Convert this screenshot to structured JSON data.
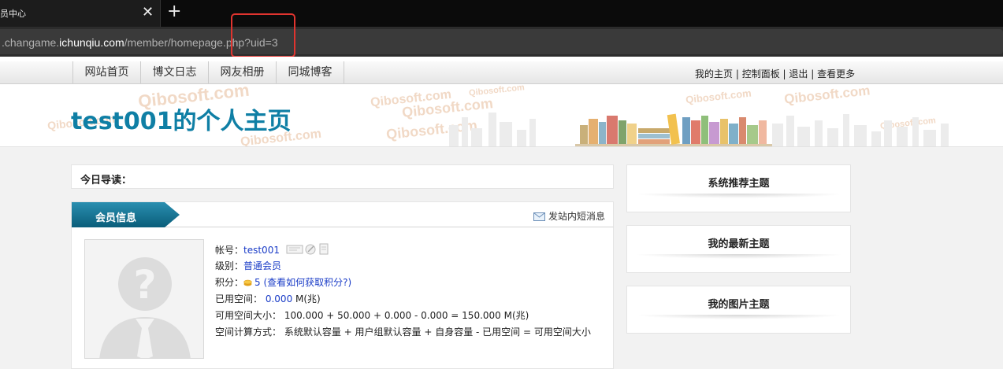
{
  "browser": {
    "tab_title": "员中心",
    "close_glyph": "✕",
    "new_tab_glyph": "+",
    "url_prefix": ".changame.",
    "url_host": "ichunqiu.com",
    "url_path": "/member/homepage.php?uid=3",
    "highlight_color": "#e0342f"
  },
  "nav": {
    "items": [
      "网站首页",
      "博文日志",
      "网友相册",
      "同城博客"
    ],
    "top_links": [
      "我的主页",
      "控制面板",
      "退出",
      "查看更多"
    ],
    "top_link_separator": " | "
  },
  "banner": {
    "title": "test001的个人主页",
    "watermark": "Qibosoft.com",
    "title_color": "#0f7fa5"
  },
  "guide": {
    "label": "今日导读："
  },
  "member": {
    "tab_label": "会员信息",
    "tab_color": "#0d6f8f",
    "pm_link": "发站内短消息",
    "account_label": "帐号：",
    "account_value": "test001",
    "level_label": "级别：",
    "level_value": "普通会员",
    "points_label": "积分：",
    "points_value": "5",
    "points_help": "(查看如何获取积分?)",
    "used_label": "已用空间：",
    "used_value": "0.000",
    "used_unit": " M(兆)",
    "avail_label": "可用空间大小：",
    "avail_value": "100.000 + 50.000 + 0.000 - 0.000 = 150.000 M(兆)",
    "calc_label": "空间计算方式：",
    "calc_value": "系统默认容量 + 用户组默认容量 + 自身容量 - 已用空间 = 可用空间大小"
  },
  "sidebar": {
    "boxes": [
      "系统推荐主题",
      "我的最新主题",
      "我的图片主题"
    ]
  },
  "icons": {
    "close": "close-icon",
    "plus": "plus-icon",
    "mail": "mail-icon",
    "coin": "coin-icon",
    "avatar": "default-avatar-icon"
  }
}
